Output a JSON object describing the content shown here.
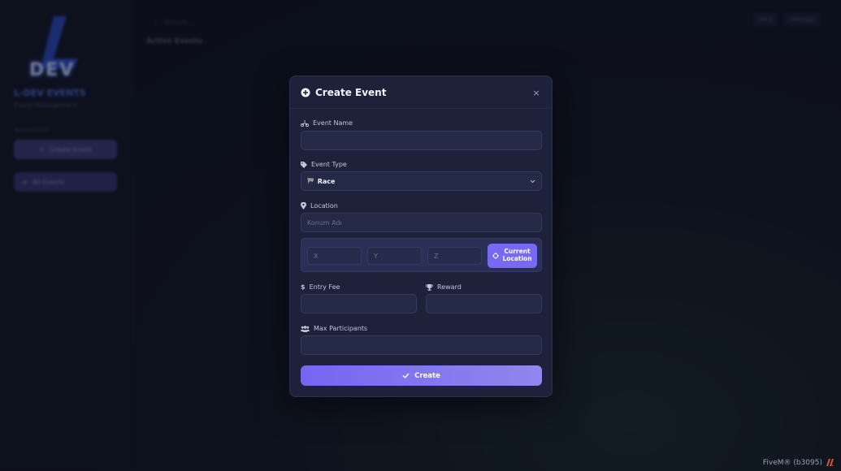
{
  "background": {
    "logo_text": "DEV",
    "brand_title": "L-DEV EVENTS",
    "brand_subtitle": "Event Management",
    "side_caption": "NAVIGATION",
    "side_buttons": [
      "Create Event",
      "All Events"
    ],
    "search_placeholder": "Search...",
    "page_heading": "Active Events",
    "top_right": [
      "Help",
      "Manager"
    ]
  },
  "modal": {
    "title": "Create Event",
    "close_symbol": "×",
    "fields": {
      "event_name": {
        "label": "Event Name",
        "value": "",
        "placeholder": ""
      },
      "event_type": {
        "label": "Event Type",
        "value": "Race",
        "icon_glyph": "🏁"
      },
      "location": {
        "label": "Location",
        "placeholder": "Konum Adı"
      },
      "coords": {
        "x_placeholder": "X",
        "y_placeholder": "Y",
        "z_placeholder": "Z"
      },
      "current_location_label_1": "Current",
      "current_location_label_2": "Location",
      "entry_fee": {
        "label": "Entry Fee",
        "value": ""
      },
      "reward": {
        "label": "Reward",
        "value": ""
      },
      "max_participants": {
        "label": "Max Participants",
        "value": ""
      }
    },
    "create_label": "Create"
  },
  "footer": {
    "text": "FiveM® (b3095)"
  },
  "colors": {
    "accent": "#7769f2",
    "modal_bg": "#1d2139",
    "input_bg": "#242945"
  }
}
